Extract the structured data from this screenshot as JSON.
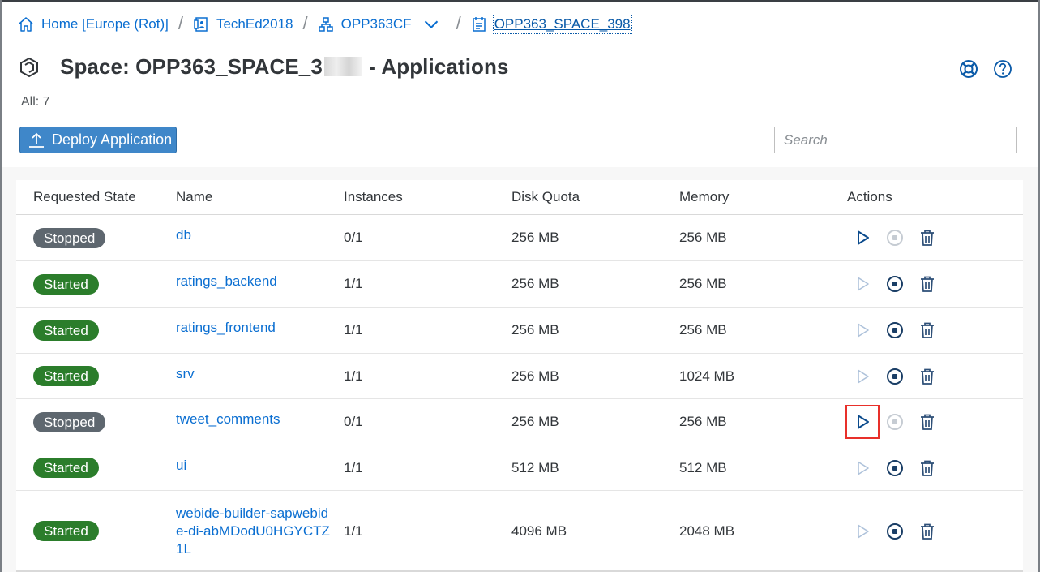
{
  "breadcrumb": {
    "home": "Home [Europe (Rot)]",
    "subaccount": "TechEd2018",
    "org": "OPP363CF",
    "space": "OPP363_SPACE_398"
  },
  "header": {
    "title_prefix": "Space: OPP363_SPACE_3",
    "title_suffix": " - Applications",
    "count": "All: 7"
  },
  "toolbar": {
    "deploy_label": "Deploy Application",
    "search_placeholder": "Search"
  },
  "table": {
    "columns": [
      "Requested State",
      "Name",
      "Instances",
      "Disk Quota",
      "Memory",
      "Actions"
    ],
    "rows": [
      {
        "state": "Stopped",
        "name": "db",
        "instances": "0/1",
        "disk": "256 MB",
        "memory": "256 MB"
      },
      {
        "state": "Started",
        "name": "ratings_backend",
        "instances": "1/1",
        "disk": "256 MB",
        "memory": "256 MB"
      },
      {
        "state": "Started",
        "name": "ratings_frontend",
        "instances": "1/1",
        "disk": "256 MB",
        "memory": "256 MB"
      },
      {
        "state": "Started",
        "name": "srv",
        "instances": "1/1",
        "disk": "256 MB",
        "memory": "1024 MB"
      },
      {
        "state": "Stopped",
        "name": "tweet_comments",
        "instances": "0/1",
        "disk": "256 MB",
        "memory": "256 MB"
      },
      {
        "state": "Started",
        "name": "ui",
        "instances": "1/1",
        "disk": "512 MB",
        "memory": "512 MB"
      },
      {
        "state": "Started",
        "name": "webide-builder-sapwebide-di-abMDodU0HGYCTZ1L",
        "instances": "1/1",
        "disk": "4096 MB",
        "memory": "2048 MB"
      }
    ]
  },
  "colors": {
    "link": "#0a6ed1",
    "started": "#2b7d2b",
    "stopped": "#5e676f",
    "primary_button": "#3f87c9",
    "highlight": "#e8302a"
  },
  "icons": {
    "home": "home-icon",
    "subaccount": "subaccount-icon",
    "org": "org-hierarchy-icon",
    "space": "space-icon",
    "start": "play-icon",
    "stop": "stop-icon",
    "delete": "trash-icon"
  }
}
